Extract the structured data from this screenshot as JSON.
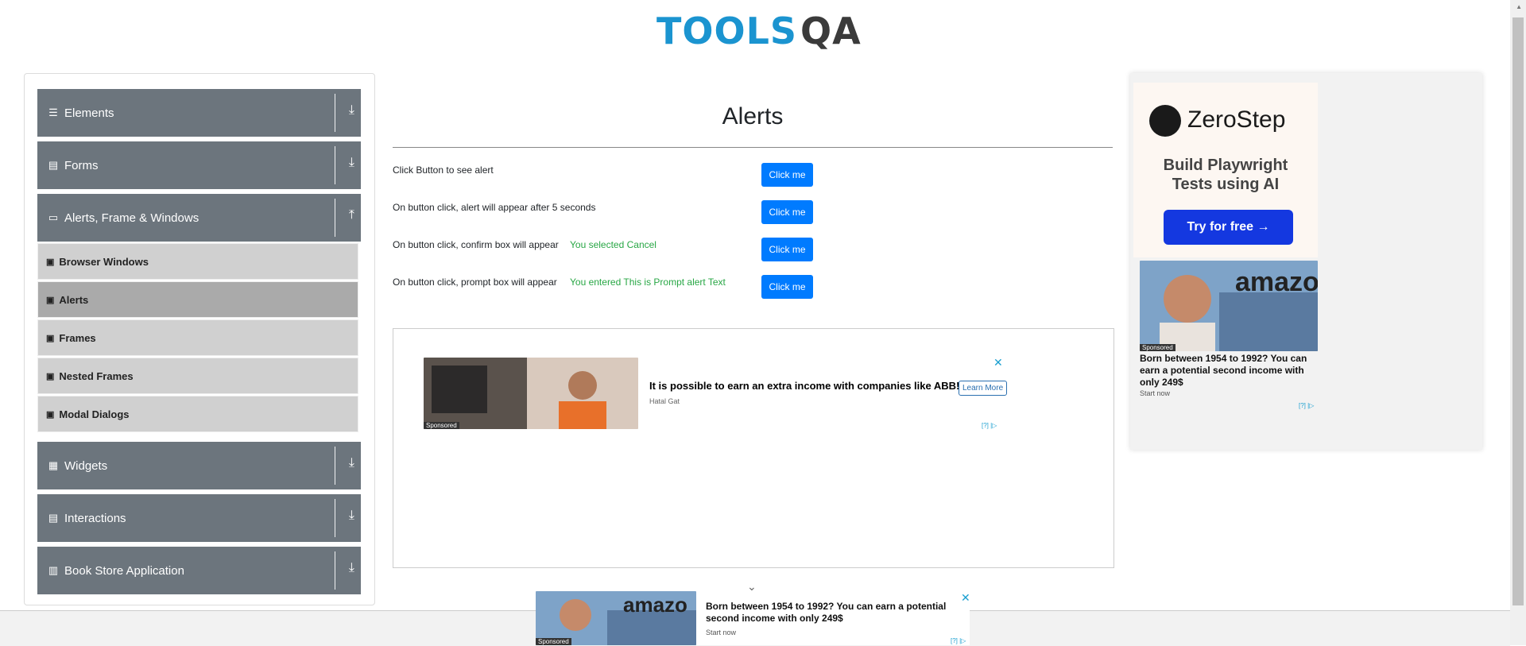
{
  "header": {
    "logo_part1": "TOOLS",
    "logo_part2": "QA"
  },
  "sidebar": {
    "groups": [
      {
        "label": "Elements",
        "icon": "hamburger-icon",
        "arrow": "⤓"
      },
      {
        "label": "Forms",
        "icon": "doc-icon",
        "arrow": "⤓"
      },
      {
        "label": "Alerts, Frame & Windows",
        "icon": "window-icon",
        "arrow": "⤒"
      },
      {
        "label": "Widgets",
        "icon": "grid-icon",
        "arrow": "⤓"
      },
      {
        "label": "Interactions",
        "icon": "box-icon",
        "arrow": "⤓"
      },
      {
        "label": "Book Store Application",
        "icon": "books-icon",
        "arrow": "⤓"
      }
    ],
    "items": [
      {
        "label": "Browser Windows"
      },
      {
        "label": "Alerts",
        "active": true
      },
      {
        "label": "Frames"
      },
      {
        "label": "Nested Frames"
      },
      {
        "label": "Modal Dialogs"
      }
    ]
  },
  "main": {
    "title": "Alerts",
    "rows": [
      {
        "label": "Click Button to see alert",
        "result": "",
        "button": "Click me"
      },
      {
        "label": "On button click, alert will appear after 5 seconds",
        "result": "",
        "button": "Click me"
      },
      {
        "label": "On button click, confirm box will appear",
        "result": "You selected Cancel",
        "button": "Click me"
      },
      {
        "label": "On button click, prompt box will appear",
        "result": "You entered This is Prompt alert Text",
        "button": "Click me"
      }
    ]
  },
  "ads": {
    "inline": {
      "sponsored": "Sponsored",
      "headline": "It is possible to earn an extra income with companies like ABB!",
      "advertiser": "Hatal Gat",
      "button": "Learn More",
      "info": "[?] |▷"
    },
    "right": {
      "brand": "ZeroStep",
      "tagline_1": "Build Playwright",
      "tagline_2": "Tests using AI",
      "cta": "Try for free →",
      "sub_sponsored": "Sponsored",
      "sub_image_text": "amazo",
      "sub_headline": "Born between 1954 to 1992? You can earn a potential second income with only 249$",
      "sub_cta": "Start now",
      "sub_info": "[?] |▷"
    },
    "bottom": {
      "sponsored": "Sponsored",
      "image_text": "amazo",
      "headline": "Born between 1954 to 1992? You can earn a potential second income with only 249$",
      "cta": "Start now",
      "info": "[?] |▷",
      "collapse": "⌄"
    }
  },
  "colors": {
    "sidebar_header": "#6c757d",
    "submenu": "#d0d0d0",
    "submenu_active": "#aaaaaa",
    "primary": "#007bff",
    "success_text": "#28a745",
    "logo_blue": "#1b94d0"
  }
}
